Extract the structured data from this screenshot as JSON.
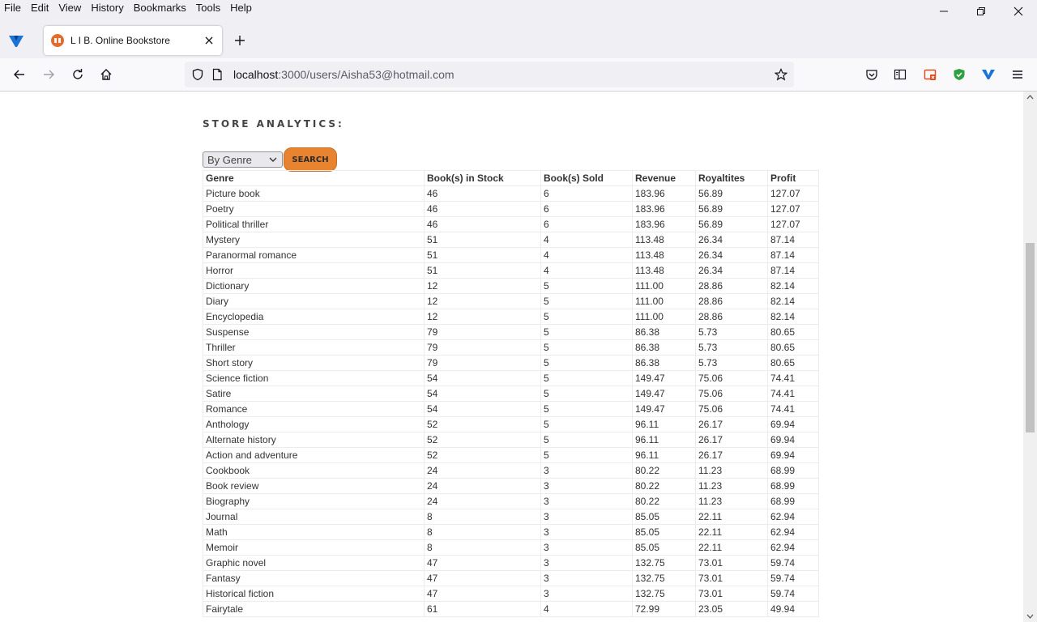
{
  "menubar": {
    "items": [
      {
        "label": "File"
      },
      {
        "label": "Edit"
      },
      {
        "label": "View"
      },
      {
        "label": "History"
      },
      {
        "label": "Bookmarks"
      },
      {
        "label": "Tools"
      },
      {
        "label": "Help"
      }
    ]
  },
  "tab": {
    "title": "L I B. Online Bookstore"
  },
  "urlbar": {
    "host": "localhost",
    "rest": ":3000/users/Aisha53@hotmail.com"
  },
  "page": {
    "heading": "STORE ANALYTICS:",
    "filter_selected": "By Genre",
    "search_label": "SEARCH"
  },
  "table": {
    "headers": [
      "Genre",
      "Book(s) in Stock",
      "Book(s) Sold",
      "Revenue",
      "Royaltites",
      "Profit"
    ],
    "rows": [
      [
        "Picture book",
        "46",
        "6",
        "183.96",
        "56.89",
        "127.07"
      ],
      [
        "Poetry",
        "46",
        "6",
        "183.96",
        "56.89",
        "127.07"
      ],
      [
        "Political thriller",
        "46",
        "6",
        "183.96",
        "56.89",
        "127.07"
      ],
      [
        "Mystery",
        "51",
        "4",
        "113.48",
        "26.34",
        "87.14"
      ],
      [
        "Paranormal romance",
        "51",
        "4",
        "113.48",
        "26.34",
        "87.14"
      ],
      [
        "Horror",
        "51",
        "4",
        "113.48",
        "26.34",
        "87.14"
      ],
      [
        "Dictionary",
        "12",
        "5",
        "111.00",
        "28.86",
        "82.14"
      ],
      [
        "Diary",
        "12",
        "5",
        "111.00",
        "28.86",
        "82.14"
      ],
      [
        "Encyclopedia",
        "12",
        "5",
        "111.00",
        "28.86",
        "82.14"
      ],
      [
        "Suspense",
        "79",
        "5",
        "86.38",
        "5.73",
        "80.65"
      ],
      [
        "Thriller",
        "79",
        "5",
        "86.38",
        "5.73",
        "80.65"
      ],
      [
        "Short story",
        "79",
        "5",
        "86.38",
        "5.73",
        "80.65"
      ],
      [
        "Science fiction",
        "54",
        "5",
        "149.47",
        "75.06",
        "74.41"
      ],
      [
        "Satire",
        "54",
        "5",
        "149.47",
        "75.06",
        "74.41"
      ],
      [
        "Romance",
        "54",
        "5",
        "149.47",
        "75.06",
        "74.41"
      ],
      [
        "Anthology",
        "52",
        "5",
        "96.11",
        "26.17",
        "69.94"
      ],
      [
        "Alternate history",
        "52",
        "5",
        "96.11",
        "26.17",
        "69.94"
      ],
      [
        "Action and adventure",
        "52",
        "5",
        "96.11",
        "26.17",
        "69.94"
      ],
      [
        "Cookbook",
        "24",
        "3",
        "80.22",
        "11.23",
        "68.99"
      ],
      [
        "Book review",
        "24",
        "3",
        "80.22",
        "11.23",
        "68.99"
      ],
      [
        "Biography",
        "24",
        "3",
        "80.22",
        "11.23",
        "68.99"
      ],
      [
        "Journal",
        "8",
        "3",
        "85.05",
        "22.11",
        "62.94"
      ],
      [
        "Math",
        "8",
        "3",
        "85.05",
        "22.11",
        "62.94"
      ],
      [
        "Memoir",
        "8",
        "3",
        "85.05",
        "22.11",
        "62.94"
      ],
      [
        "Graphic novel",
        "47",
        "3",
        "132.75",
        "73.01",
        "59.74"
      ],
      [
        "Fantasy",
        "47",
        "3",
        "132.75",
        "73.01",
        "59.74"
      ],
      [
        "Historical fiction",
        "47",
        "3",
        "132.75",
        "73.01",
        "59.74"
      ],
      [
        "Fairytale",
        "61",
        "4",
        "72.99",
        "23.05",
        "49.94"
      ]
    ]
  }
}
